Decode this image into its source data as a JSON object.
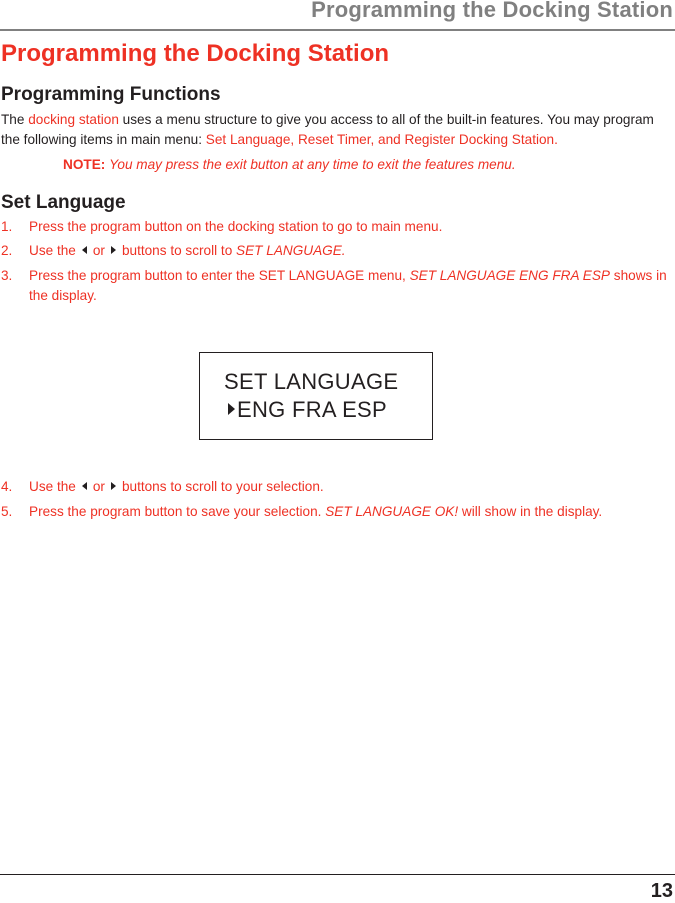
{
  "running_head": "Programming the Docking Station",
  "title": "Programming the Docking Station",
  "section_programming_functions": {
    "heading": "Programming Functions",
    "para_prefix": "The ",
    "para_link": "docking station",
    "para_middle": " uses a menu structure to give you access to all of the built-in features. You may program the following items in main menu: ",
    "para_items": "Set Language, Reset Timer, and Register Docking Station."
  },
  "note": {
    "label": "NOTE:",
    "text": "You may press the exit button at any time to exit the features menu."
  },
  "section_set_language": {
    "heading": "Set Language",
    "steps": [
      {
        "num": "1.",
        "text": "Press the program button on the docking station to go to main menu."
      },
      {
        "num": "2.",
        "pre": "Use the",
        "or": "or",
        "post": "buttons to scroll to ",
        "italic": "SET LANGUAGE."
      },
      {
        "num": "3.",
        "pre": "Press the program button to enter the SET LANGUAGE menu, ",
        "italic": "SET LANGUAGE  ENG  FRA  ESP",
        "post": " shows in the display."
      },
      {
        "num": "4.",
        "pre": "Use the",
        "or": "or",
        "post": "buttons to scroll to your selection."
      },
      {
        "num": "5.",
        "pre": "Press the program button to save your selection. ",
        "italic": "SET LANGUAGE OK!",
        "post": "  will show in the display."
      }
    ]
  },
  "display": {
    "line1": "SET LANGUAGE",
    "line2": "ENG  FRA  ESP",
    "cursor_icon": "triangle-right-icon"
  },
  "icons": {
    "left": "triangle-left-icon",
    "right": "triangle-right-icon"
  },
  "page_number": "13"
}
